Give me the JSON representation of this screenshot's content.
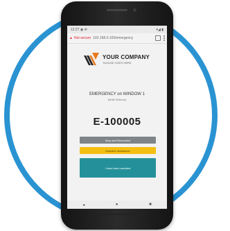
{
  "status_bar": {
    "time": "12:27",
    "left_icons": "◉ ✉",
    "right_icons": "▾◢ ▮"
  },
  "browser": {
    "insecure_label": "Not secure",
    "url": "192.168.0.100/emergency"
  },
  "logo": {
    "company": "YOUR COMPANY",
    "tagline": "TAGLINE GOES HERE"
  },
  "alert": {
    "title": "EMERGENCY on WINDOW 1",
    "subtitle": "(Multi Delivery)",
    "code": "E-100005"
  },
  "buttons": {
    "grey": "Stop and Reconnect",
    "yellow": "Dispatch assistance",
    "teal": "I have been assisted"
  },
  "nav": {
    "back": "◂",
    "home": "●",
    "recent": "■"
  },
  "colors": {
    "ring": "#2a93d2",
    "grey_button": "#7e8488",
    "yellow_button": "#f5bf12",
    "teal_button": "#24919a"
  }
}
